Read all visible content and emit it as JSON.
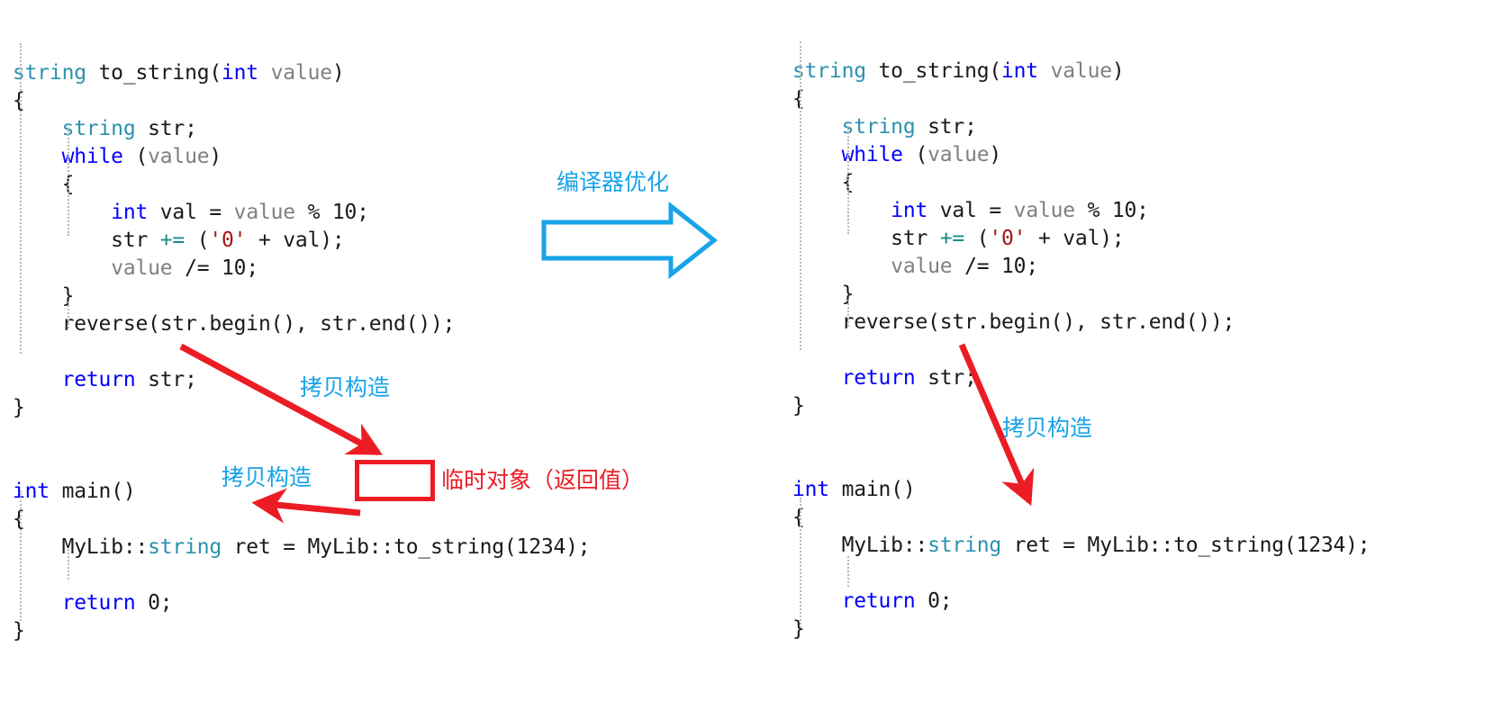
{
  "diagram": {
    "title": "compiler-optimization-copy-elision",
    "colors": {
      "accent_blue": "#18a3e8",
      "accent_red": "#ec1c24",
      "kw_blue": "#0000ff",
      "type_teal": "#2b91af",
      "var_gray": "#808080",
      "str_darkred": "#a31515",
      "op_teal": "#1a8a8a",
      "background": "#ffffff"
    }
  },
  "left_code": {
    "lines": [
      [
        {
          "t": "string",
          "c": "type"
        },
        {
          "t": " to_string(",
          "c": "plain"
        },
        {
          "t": "int",
          "c": "kw"
        },
        {
          "t": " ",
          "c": "plain"
        },
        {
          "t": "value",
          "c": "var"
        },
        {
          "t": ")",
          "c": "plain"
        }
      ],
      [
        {
          "t": "{",
          "c": "plain"
        }
      ],
      [
        {
          "t": "    ",
          "c": "plain"
        },
        {
          "t": "string",
          "c": "type"
        },
        {
          "t": " str;",
          "c": "plain"
        }
      ],
      [
        {
          "t": "    ",
          "c": "plain"
        },
        {
          "t": "while",
          "c": "kw"
        },
        {
          "t": " (",
          "c": "plain"
        },
        {
          "t": "value",
          "c": "var"
        },
        {
          "t": ")",
          "c": "plain"
        }
      ],
      [
        {
          "t": "    {",
          "c": "plain"
        }
      ],
      [
        {
          "t": "        ",
          "c": "plain"
        },
        {
          "t": "int",
          "c": "kw"
        },
        {
          "t": " val = ",
          "c": "plain"
        },
        {
          "t": "value",
          "c": "var"
        },
        {
          "t": " % 10;",
          "c": "plain"
        }
      ],
      [
        {
          "t": "        str ",
          "c": "plain"
        },
        {
          "t": "+=",
          "c": "op"
        },
        {
          "t": " (",
          "c": "plain"
        },
        {
          "t": "'0'",
          "c": "str"
        },
        {
          "t": " + val);",
          "c": "plain"
        }
      ],
      [
        {
          "t": "        ",
          "c": "plain"
        },
        {
          "t": "value",
          "c": "var"
        },
        {
          "t": " /= 10;",
          "c": "plain"
        }
      ],
      [
        {
          "t": "    }",
          "c": "plain"
        }
      ],
      [
        {
          "t": "    reverse(str.begin(), str.end());",
          "c": "plain"
        }
      ],
      [
        {
          "t": "",
          "c": "plain"
        }
      ],
      [
        {
          "t": "    ",
          "c": "plain"
        },
        {
          "t": "return",
          "c": "kw"
        },
        {
          "t": " str;",
          "c": "plain"
        }
      ],
      [
        {
          "t": "}",
          "c": "plain"
        }
      ],
      [
        {
          "t": "",
          "c": "plain"
        }
      ],
      [
        {
          "t": "",
          "c": "plain"
        }
      ],
      [
        {
          "t": "int",
          "c": "kw"
        },
        {
          "t": " main()",
          "c": "plain"
        }
      ],
      [
        {
          "t": "{",
          "c": "plain"
        }
      ],
      [
        {
          "t": "    MyLib::",
          "c": "plain"
        },
        {
          "t": "string",
          "c": "type"
        },
        {
          "t": " ret = MyLib::to_string(1234);",
          "c": "plain"
        }
      ],
      [
        {
          "t": "",
          "c": "plain"
        }
      ],
      [
        {
          "t": "    ",
          "c": "plain"
        },
        {
          "t": "return",
          "c": "kw"
        },
        {
          "t": " 0;",
          "c": "plain"
        }
      ],
      [
        {
          "t": "}",
          "c": "plain"
        }
      ]
    ],
    "plain_text": "string to_string(int value)\n{\n    string str;\n    while (value)\n    {\n        int val = value % 10;\n        str += ('0' + val);\n        value /= 10;\n    }\n    reverse(str.begin(), str.end());\n\n    return str;\n}\n\n\nint main()\n{\n    MyLib::string ret = MyLib::to_string(1234);\n\n    return 0;\n}"
  },
  "right_code": {
    "lines": [
      [
        {
          "t": "string",
          "c": "type"
        },
        {
          "t": " to_string(",
          "c": "plain"
        },
        {
          "t": "int",
          "c": "kw"
        },
        {
          "t": " ",
          "c": "plain"
        },
        {
          "t": "value",
          "c": "var"
        },
        {
          "t": ")",
          "c": "plain"
        }
      ],
      [
        {
          "t": "{",
          "c": "plain"
        }
      ],
      [
        {
          "t": "    ",
          "c": "plain"
        },
        {
          "t": "string",
          "c": "type"
        },
        {
          "t": " str;",
          "c": "plain"
        }
      ],
      [
        {
          "t": "    ",
          "c": "plain"
        },
        {
          "t": "while",
          "c": "kw"
        },
        {
          "t": " (",
          "c": "plain"
        },
        {
          "t": "value",
          "c": "var"
        },
        {
          "t": ")",
          "c": "plain"
        }
      ],
      [
        {
          "t": "    {",
          "c": "plain"
        }
      ],
      [
        {
          "t": "        ",
          "c": "plain"
        },
        {
          "t": "int",
          "c": "kw"
        },
        {
          "t": " val = ",
          "c": "plain"
        },
        {
          "t": "value",
          "c": "var"
        },
        {
          "t": " % 10;",
          "c": "plain"
        }
      ],
      [
        {
          "t": "        str ",
          "c": "plain"
        },
        {
          "t": "+=",
          "c": "op"
        },
        {
          "t": " (",
          "c": "plain"
        },
        {
          "t": "'0'",
          "c": "str"
        },
        {
          "t": " + val);",
          "c": "plain"
        }
      ],
      [
        {
          "t": "        ",
          "c": "plain"
        },
        {
          "t": "value",
          "c": "var"
        },
        {
          "t": " /= 10;",
          "c": "plain"
        }
      ],
      [
        {
          "t": "    }",
          "c": "plain"
        }
      ],
      [
        {
          "t": "    reverse(str.begin(), str.end());",
          "c": "plain"
        }
      ],
      [
        {
          "t": "",
          "c": "plain"
        }
      ],
      [
        {
          "t": "    ",
          "c": "plain"
        },
        {
          "t": "return",
          "c": "kw"
        },
        {
          "t": " str;",
          "c": "plain"
        }
      ],
      [
        {
          "t": "}",
          "c": "plain"
        }
      ],
      [
        {
          "t": "",
          "c": "plain"
        }
      ],
      [
        {
          "t": "",
          "c": "plain"
        }
      ],
      [
        {
          "t": "int",
          "c": "kw"
        },
        {
          "t": " main()",
          "c": "plain"
        }
      ],
      [
        {
          "t": "{",
          "c": "plain"
        }
      ],
      [
        {
          "t": "    MyLib::",
          "c": "plain"
        },
        {
          "t": "string",
          "c": "type"
        },
        {
          "t": " ret = MyLib::to_string(1234);",
          "c": "plain"
        }
      ],
      [
        {
          "t": "",
          "c": "plain"
        }
      ],
      [
        {
          "t": "    ",
          "c": "plain"
        },
        {
          "t": "return",
          "c": "kw"
        },
        {
          "t": " 0;",
          "c": "plain"
        }
      ],
      [
        {
          "t": "}",
          "c": "plain"
        }
      ]
    ],
    "plain_text": "string to_string(int value)\n{\n    string str;\n    while (value)\n    {\n        int val = value % 10;\n        str += ('0' + val);\n        value /= 10;\n    }\n    reverse(str.begin(), str.end());\n\n    return str;\n}\n\n\nint main()\n{\n    MyLib::string ret = MyLib::to_string(1234);\n\n    return 0;\n}"
  },
  "annotations": {
    "compiler_optimization": "编译器优化",
    "copy_ctor_left_top": "拷贝构造",
    "copy_ctor_left_bottom": "拷贝构造",
    "copy_ctor_right": "拷贝构造",
    "temp_object_label": "临时对象（返回值）"
  }
}
